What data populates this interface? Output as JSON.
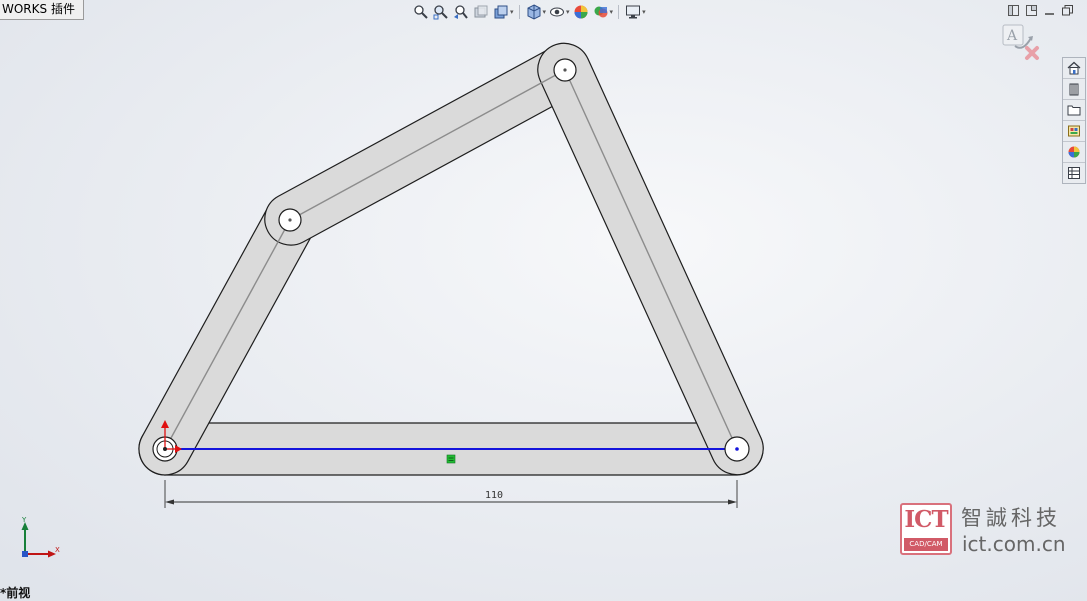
{
  "tab": {
    "label": "WORKS 插件"
  },
  "heads_up_toolbar": {
    "tools": [
      {
        "name": "zoom-to-fit-icon"
      },
      {
        "name": "zoom-to-area-icon"
      },
      {
        "name": "previous-view-icon"
      },
      {
        "name": "section-view-icon"
      },
      {
        "name": "dynamic-annotation-icon"
      },
      {
        "name": "view-orientation-icon"
      },
      {
        "name": "display-style-icon"
      },
      {
        "name": "hide-show-items-icon"
      },
      {
        "name": "edit-appearance-icon"
      },
      {
        "name": "apply-scene-icon"
      },
      {
        "name": "view-settings-icon"
      }
    ]
  },
  "colors": {
    "link_fill": "#dadada",
    "link_outline": "#1e1e1e",
    "centerline": "#8c8c8c",
    "selected_line": "#1414dc",
    "relation_marker": "#22bb33",
    "origin_arrow": "#e01010",
    "axis_y": "#17803a",
    "axis_x": "#c01515",
    "watermark": "#d15a67"
  },
  "sketch": {
    "dimension_value": "110"
  },
  "triad": {
    "x_label": "X",
    "y_label": "Y"
  },
  "view": {
    "name": "*前视"
  },
  "watermark": {
    "logo_text": "ICT",
    "logo_sub": "CAD/CAM",
    "company": "智誠科技",
    "url": "ict.com.cn"
  }
}
